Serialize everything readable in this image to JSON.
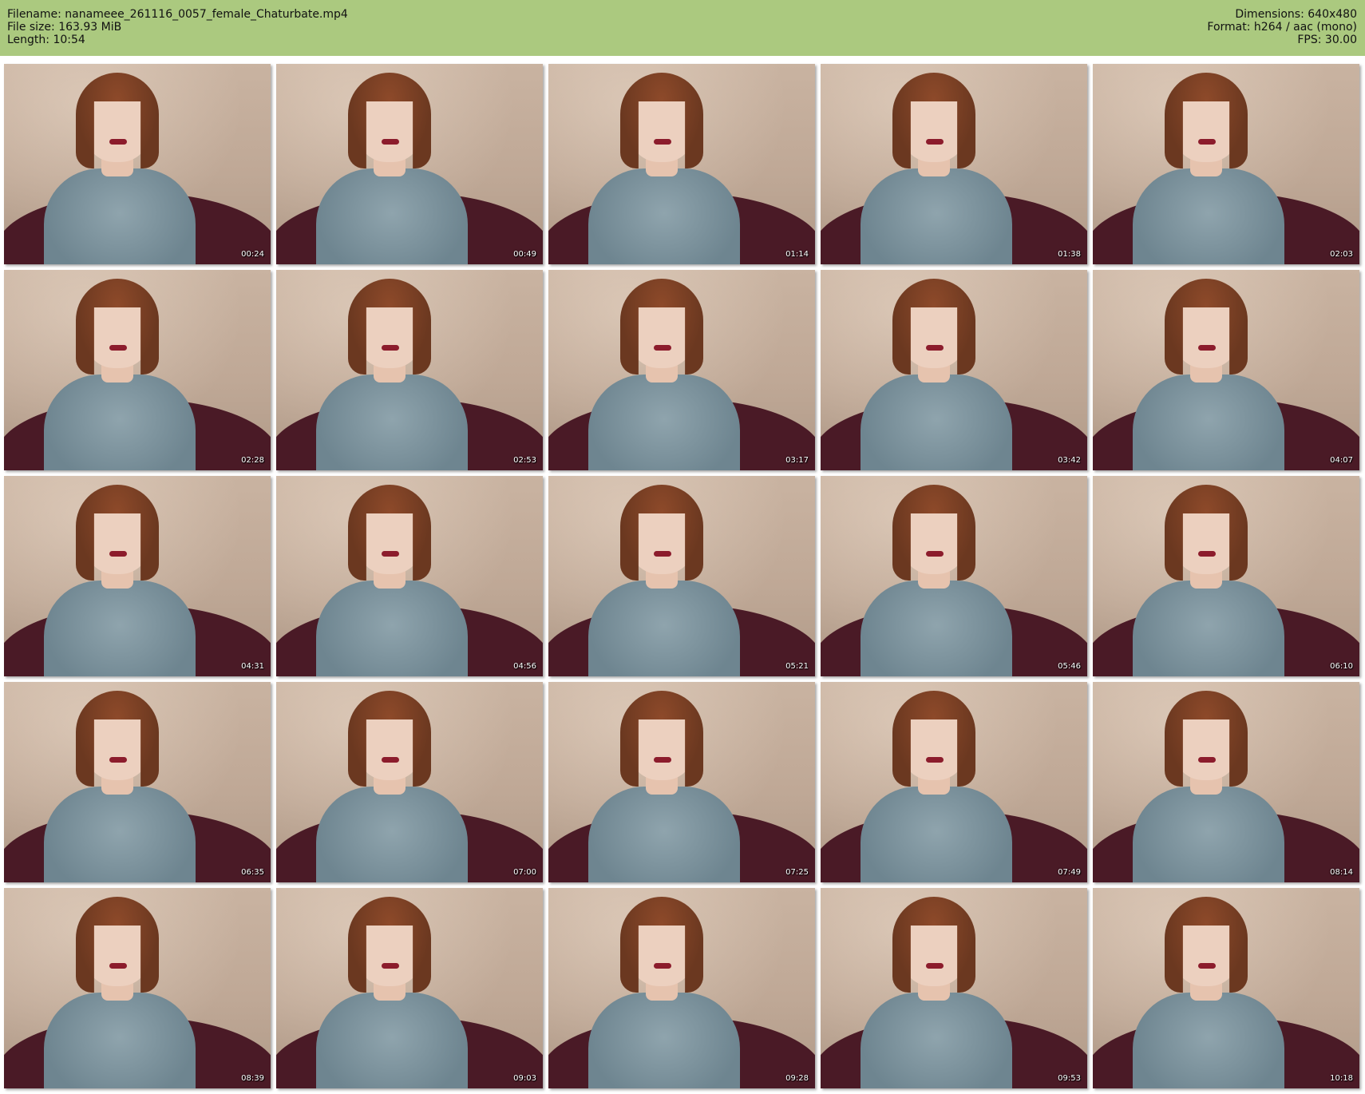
{
  "header": {
    "filename": "Filename: nanameee_261116_0057_female_Chaturbate.mp4",
    "filesize": "File size: 163.93 MiB",
    "length": "Length: 10:54",
    "dimensions": "Dimensions: 640x480",
    "format": "Format: h264 / aac (mono)",
    "fps": "FPS: 30.00"
  },
  "colors": {
    "header_bg": "#abc97f",
    "background": "#ffffff"
  },
  "thumbnails": [
    {
      "time": "00:24"
    },
    {
      "time": "00:49"
    },
    {
      "time": "01:14"
    },
    {
      "time": "01:38"
    },
    {
      "time": "02:03"
    },
    {
      "time": "02:28"
    },
    {
      "time": "02:53"
    },
    {
      "time": "03:17"
    },
    {
      "time": "03:42"
    },
    {
      "time": "04:07"
    },
    {
      "time": "04:31"
    },
    {
      "time": "04:56"
    },
    {
      "time": "05:21"
    },
    {
      "time": "05:46"
    },
    {
      "time": "06:10"
    },
    {
      "time": "06:35"
    },
    {
      "time": "07:00"
    },
    {
      "time": "07:25"
    },
    {
      "time": "07:49"
    },
    {
      "time": "08:14"
    },
    {
      "time": "08:39"
    },
    {
      "time": "09:03"
    },
    {
      "time": "09:28"
    },
    {
      "time": "09:53"
    },
    {
      "time": "10:18"
    }
  ]
}
